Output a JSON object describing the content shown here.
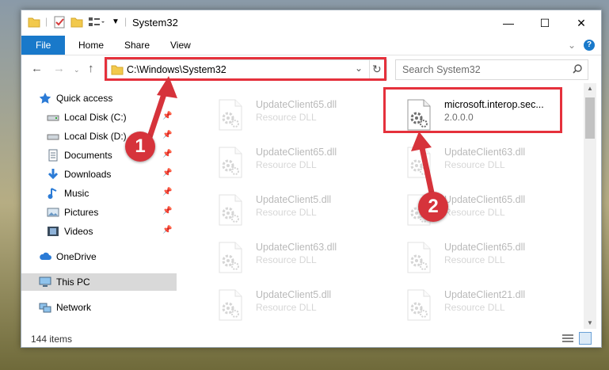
{
  "window": {
    "title": "System32",
    "controls": {
      "minimize": "—",
      "maximize": "☐",
      "close": "✕"
    }
  },
  "ribbon": {
    "tabs": [
      "File",
      "Home",
      "Share",
      "View"
    ],
    "expand_icon": "chevron-down-icon",
    "help_icon": "help-icon"
  },
  "navigation": {
    "address": "C:\\Windows\\System32",
    "search_placeholder": "Search System32"
  },
  "sidebar": {
    "items": [
      {
        "label": "Quick access",
        "icon": "star-icon"
      },
      {
        "label": "Local Disk (C:)",
        "icon": "drive-icon",
        "pinned": true
      },
      {
        "label": "Local Disk (D:)",
        "icon": "drive-icon",
        "pinned": true
      },
      {
        "label": "Documents",
        "icon": "documents-icon",
        "pinned": true
      },
      {
        "label": "Downloads",
        "icon": "download-icon",
        "pinned": true
      },
      {
        "label": "Music",
        "icon": "music-icon",
        "pinned": true
      },
      {
        "label": "Pictures",
        "icon": "pictures-icon",
        "pinned": true
      },
      {
        "label": "Videos",
        "icon": "videos-icon",
        "pinned": true
      },
      {
        "label": "OneDrive",
        "icon": "cloud-icon"
      },
      {
        "label": "This PC",
        "icon": "computer-icon",
        "selected": true
      },
      {
        "label": "Network",
        "icon": "network-icon"
      }
    ]
  },
  "files": [
    {
      "name": "UpdateClient65.dll",
      "type": "Resource DLL"
    },
    {
      "name": "microsoft.interop.sec...",
      "type": "2.0.0.0"
    },
    {
      "name": "UpdateClient65.dll",
      "type": "Resource DLL"
    },
    {
      "name": "UpdateClient63.dll",
      "type": "Resource DLL"
    },
    {
      "name": "UpdateClient5.dll",
      "type": "Resource DLL"
    },
    {
      "name": "UpdateClient65.dll",
      "type": "Resource DLL"
    },
    {
      "name": "UpdateClient63.dll",
      "type": "Resource DLL"
    },
    {
      "name": "UpdateClient65.dll",
      "type": "Resource DLL"
    },
    {
      "name": "UpdateClient5.dll",
      "type": "Resource DLL"
    },
    {
      "name": "UpdateClient21.dll",
      "type": "Resource DLL"
    }
  ],
  "status": {
    "item_count": "144 items"
  },
  "annotations": {
    "badge1": "1",
    "badge2": "2",
    "color": "#d6333b"
  }
}
